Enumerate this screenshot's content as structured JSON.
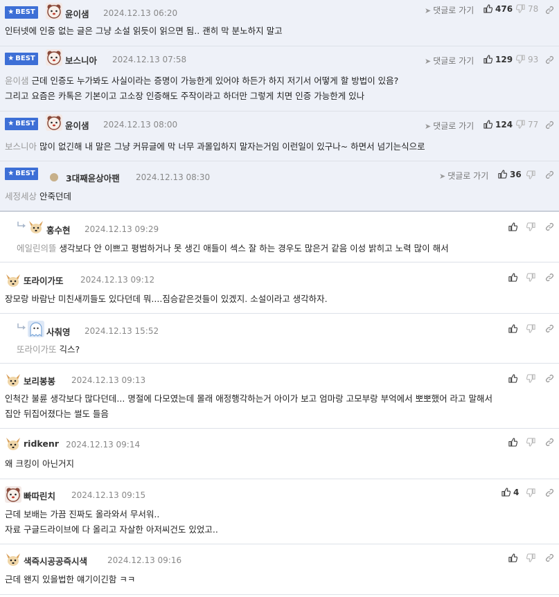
{
  "labels": {
    "best": "BEST",
    "reply": "댓글로 가기"
  },
  "comments": [
    {
      "nick": "윤이샘",
      "date": "2024.12.13 06:20",
      "likes": "476",
      "dislikes": "78",
      "body": "인터넷에 인증 없는 글은 그냥 소설 읽듯이 읽으면 됨.. 괜히 막 분노하지 말고",
      "mention": ""
    },
    {
      "nick": "보스니아",
      "date": "2024.12.13 07:58",
      "likes": "129",
      "dislikes": "93",
      "mention": "윤이샘",
      "body": "근데 인증도 누가봐도 사실이라는 증명이 가능한게 있어야 하든가 하지 저기서 어떻게 할 방법이 있음?",
      "body2": "그리고 요즘은 카톡은 기본이고 고소장 인증해도 주작이라고 하더만 그렇게 치면 인증 가능한게 있나"
    },
    {
      "nick": "윤이샘",
      "date": "2024.12.13 08:00",
      "likes": "124",
      "dislikes": "77",
      "mention": "보스니아",
      "body": "많이 없긴해 내 말은 그냥 커뮤글에 막 너무 과몰입하지 말자는거임 이런일이 있구나~ 하면서 넘기는식으로"
    },
    {
      "nick": "3대째윤상아팬",
      "date": "2024.12.13 08:30",
      "likes": "36",
      "mention": "세정세상",
      "body": "안죽던데"
    },
    {
      "nick": "홍수현",
      "date": "2024.12.13 09:29",
      "mention": "에일린의뜰",
      "body": "생각보다 안 이쁘고 평범하거나 못 생긴 애들이 섹스 잘 하는 경우도 많은거 같음 이성 밝히고 노력 많이 해서"
    },
    {
      "nick": "또라이가또",
      "date": "2024.12.13 09:12",
      "body": "장모랑 바람난 미친새끼들도 있다던데 뭐....짐승같은것들이 있겠지. 소설이라고 생각하자."
    },
    {
      "nick": "사춰영",
      "date": "2024.12.13 15:52",
      "mention": "또라이가또",
      "body": "긱스?"
    },
    {
      "nick": "보리봉봉",
      "date": "2024.12.13 09:13",
      "body": "인척간 불륜 생각보다 많다던데... 명절에 다모였는데 몰래 애정행각하는거 아이가 보고 엄마랑 고모부랑 부억에서 뽀뽀했어 라고 말해서",
      "body2": "집안 뒤집어졌다는 썰도 들음"
    },
    {
      "nick": "ridkenr",
      "date": "2024.12.13 09:14",
      "body": "왜 크킹이 아닌거지"
    },
    {
      "nick": "빠따린치",
      "date": "2024.12.13 09:15",
      "likes": "4",
      "body": "근데 보배는 가끔 진짜도 올라와서 무서워..",
      "body2": "자료 구글드라이브에 다 올리고 자살한 아저씨건도 있었고.."
    },
    {
      "nick": "색즉시공공즉시색",
      "date": "2024.12.13 09:16",
      "body": "근데 왠지 있을법한 얘기이긴함 ㅋㅋ"
    }
  ],
  "colors": {
    "best_bg": "#eef1f8",
    "badge": "#3d6fd6",
    "mention": "#999999"
  },
  "icons": [
    "thumbs-up-icon",
    "thumbs-down-icon",
    "link-icon",
    "reply-arrow-icon"
  ]
}
